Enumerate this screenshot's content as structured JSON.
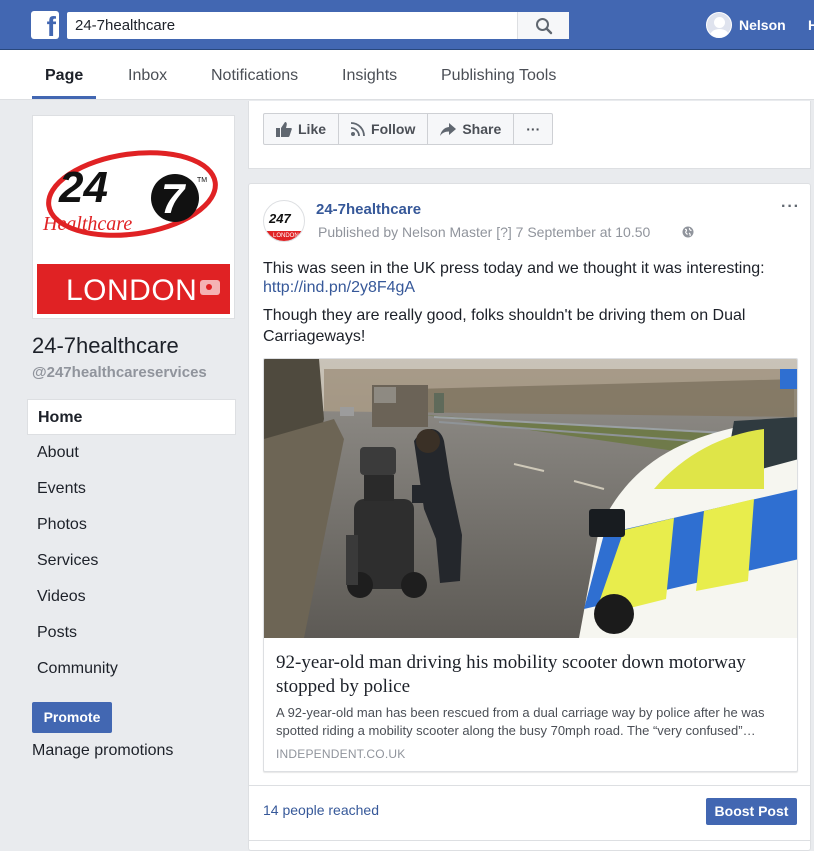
{
  "topbar": {
    "logo_letter": "f",
    "search_value": "24-7healthcare",
    "user_name": "Nelson",
    "home_label": "H"
  },
  "page_nav": {
    "tabs": [
      {
        "label": "Page"
      },
      {
        "label": "Inbox"
      },
      {
        "label": "Notifications"
      },
      {
        "label": "Insights"
      },
      {
        "label": "Publishing Tools"
      }
    ]
  },
  "left": {
    "logo": {
      "number": "24",
      "seven": "7",
      "tm": "TM",
      "script": "Healthcare",
      "city": "LONDON"
    },
    "page_title": "24-7healthcare",
    "page_handle": "@247healthcareservices",
    "nav": [
      {
        "label": "Home"
      },
      {
        "label": "About"
      },
      {
        "label": "Events"
      },
      {
        "label": "Photos"
      },
      {
        "label": "Services"
      },
      {
        "label": "Videos"
      },
      {
        "label": "Posts"
      },
      {
        "label": "Community"
      }
    ],
    "promote_label": "Promote",
    "manage_label": "Manage promotions"
  },
  "actions": {
    "like": "Like",
    "follow": "Follow",
    "share": "Share",
    "more": "···"
  },
  "post": {
    "avatar": {
      "number": "24",
      "seven": "7",
      "city": "LONDON"
    },
    "author": "24-7healthcare",
    "meta": "Published by Nelson Master [?] 7 September at 10.50",
    "more": "···",
    "text1": "This was seen in the UK press today and we thought it was interesting:",
    "link": "http://ind.pn/2y8F4gA",
    "text2": "Though they are really good, folks shouldn't be driving them on Dual Carriageways!",
    "card": {
      "title": "92-year-old man driving his mobility scooter down motorway stopped by police",
      "description": "A 92-year-old man has been rescued from a dual carriage way by police after he was spotted riding a mobility scooter along the busy 70mph road. The “very confused”…",
      "domain": "INDEPENDENT.CO.UK"
    },
    "reach": "14 people reached",
    "boost_label": "Boost Post"
  },
  "colors": {
    "fb_blue": "#4267b2",
    "link_blue": "#365899",
    "brand_red": "#e02224"
  }
}
